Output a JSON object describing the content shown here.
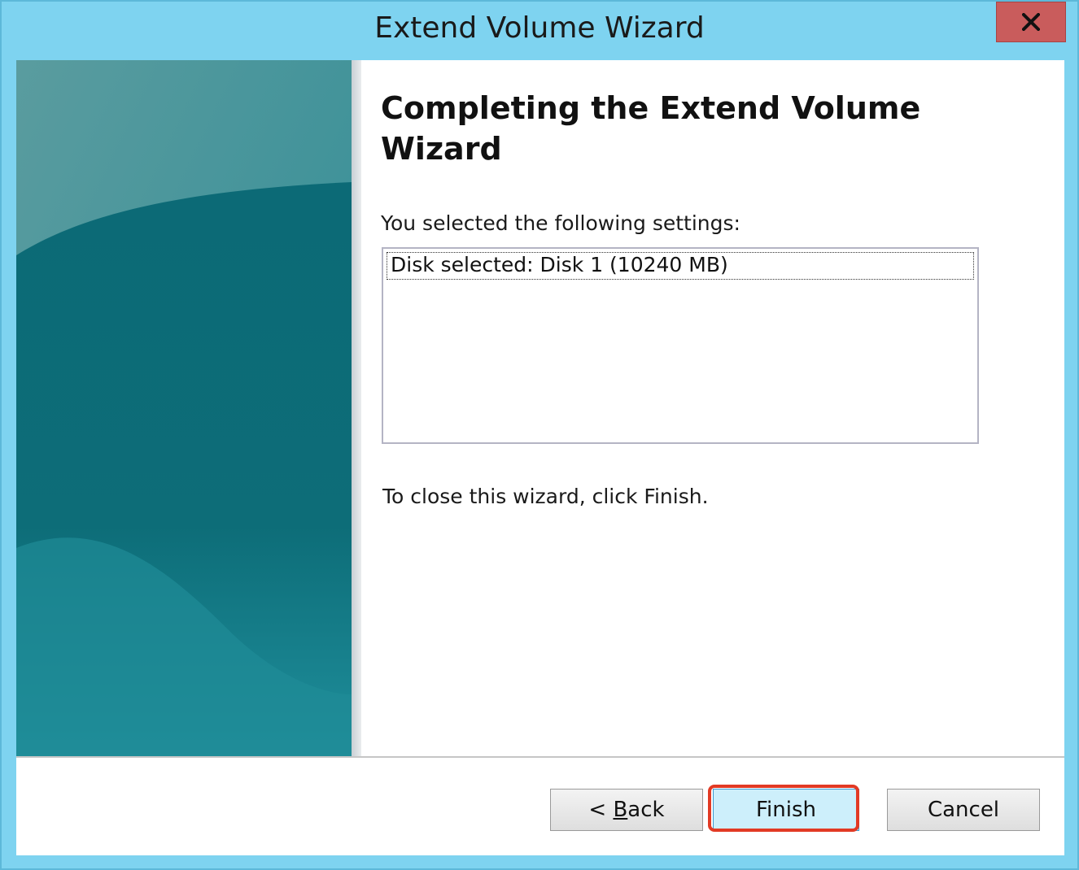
{
  "window": {
    "title": "Extend Volume Wizard",
    "close_icon": "close-x-icon"
  },
  "page": {
    "heading": "Completing the Extend Volume Wizard",
    "settings_label": "You selected the following settings:",
    "settings": [
      "Disk selected: Disk 1 (10240 MB)"
    ],
    "close_hint": "To close this wizard, click Finish."
  },
  "buttons": {
    "back_prefix": "< ",
    "back_mnemonic": "B",
    "back_rest": "ack",
    "finish": "Finish",
    "cancel": "Cancel"
  },
  "colors": {
    "titlebar": "#7ed3f0",
    "close_button": "#c95c5c",
    "finish_highlight": "#e23a24",
    "banner": "#0f6f7a"
  }
}
